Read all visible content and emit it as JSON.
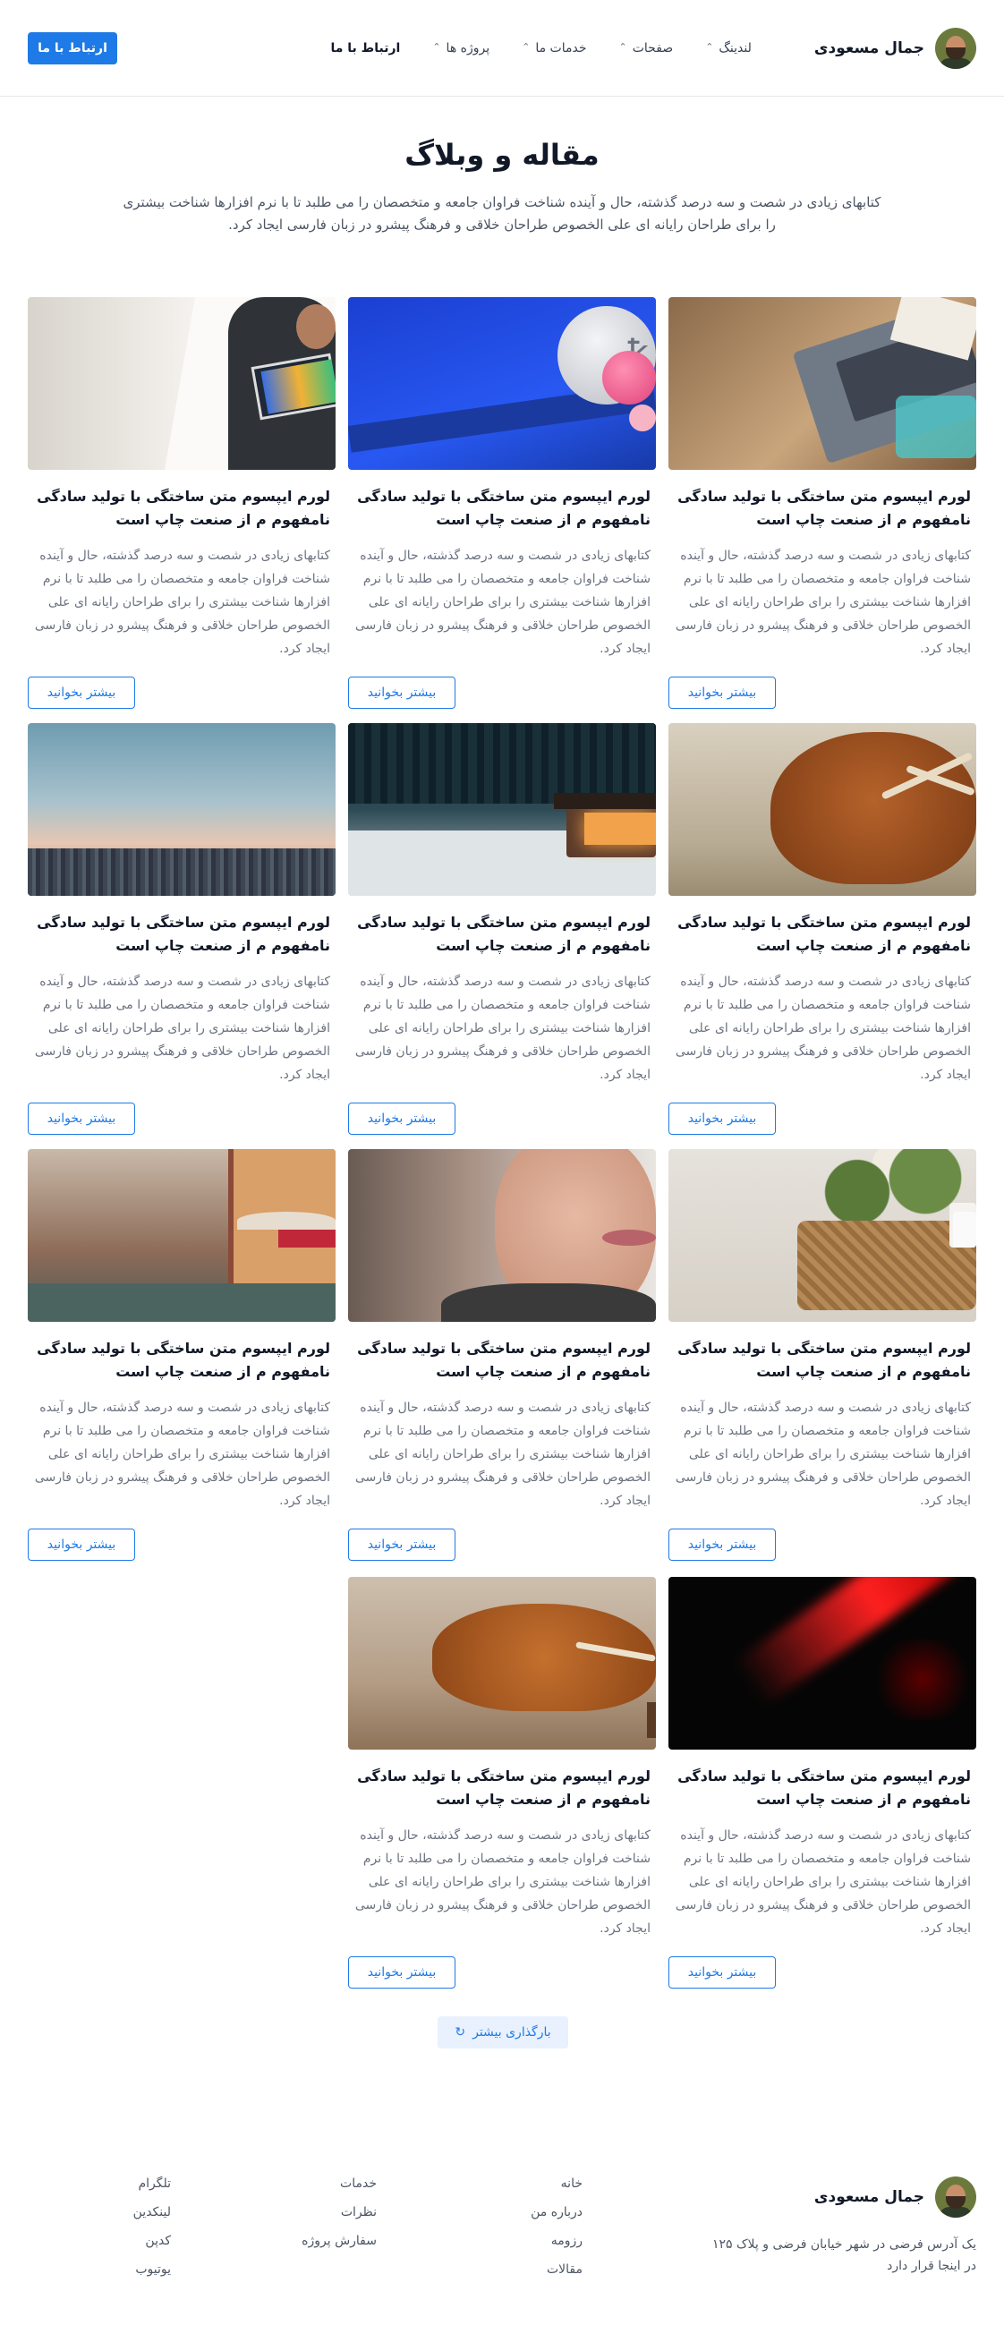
{
  "header": {
    "brand_name": "جمال مسعودی",
    "nav": [
      {
        "label": "لندینگ",
        "has_dropdown": true
      },
      {
        "label": "صفحات",
        "has_dropdown": true
      },
      {
        "label": "خدمات ما",
        "has_dropdown": true
      },
      {
        "label": "پروژه ها",
        "has_dropdown": true
      },
      {
        "label": "ارتباط با ما",
        "has_dropdown": false
      }
    ],
    "cta_label": "ارتباط با ما"
  },
  "hero": {
    "title": "مقاله و وبلاگ",
    "subtitle": "کتابهای زیادی در شصت و سه درصد گذشته، حال و آینده شناخت فراوان جامعه و متخصصان را می طلبد تا با نرم افزارها شناخت بیشتری را برای طراحان رایانه ای علی الخصوص طراحان خلاقی و فرهنگ پیشرو در زبان فارسی ایجاد کرد."
  },
  "posts": [
    {
      "image": "laptop-desk",
      "title": "لورم ایپسوم متن ساختگی با تولید سادگی نامفهوم م از صنعت چاپ است",
      "excerpt": "کتابهای زیادی در شصت و سه درصد گذشته، حال و آینده شناخت فراوان جامعه و متخصصان را می طلبد تا با نرم افزارها شناخت بیشتری را برای طراحان رایانه ای علی الخصوص طراحان خلاقی و فرهنگ پیشرو در زبان فارسی ایجاد کرد.",
      "read_more": "بیشتر بخوانید"
    },
    {
      "image": "crypto-coin",
      "title": "لورم ایپسوم متن ساختگی با تولید سادگی نامفهوم م از صنعت چاپ است",
      "excerpt": "کتابهای زیادی در شصت و سه درصد گذشته، حال و آینده شناخت فراوان جامعه و متخصصان را می طلبد تا با نرم افزارها شناخت بیشتری را برای طراحان رایانه ای علی الخصوص طراحان خلاقی و فرهنگ پیشرو در زبان فارسی ایجاد کرد.",
      "read_more": "بیشتر بخوانید"
    },
    {
      "image": "artist-tablet",
      "title": "لورم ایپسوم متن ساختگی با تولید سادگی نامفهوم م از صنعت چاپ است",
      "excerpt": "کتابهای زیادی در شصت و سه درصد گذشته، حال و آینده شناخت فراوان جامعه و متخصصان را می طلبد تا با نرم افزارها شناخت بیشتری را برای طراحان رایانه ای علی الخصوص طراحان خلاقی و فرهنگ پیشرو در زبان فارسی ایجاد کرد.",
      "read_more": "بیشتر بخوانید"
    },
    {
      "image": "highland-cow",
      "title": "لورم ایپسوم متن ساختگی با تولید سادگی نامفهوم م از صنعت چاپ است",
      "excerpt": "کتابهای زیادی در شصت و سه درصد گذشته، حال و آینده شناخت فراوان جامعه و متخصصان را می طلبد تا با نرم افزارها شناخت بیشتری را برای طراحان رایانه ای علی الخصوص طراحان خلاقی و فرهنگ پیشرو در زبان فارسی ایجاد کرد.",
      "read_more": "بیشتر بخوانید"
    },
    {
      "image": "cabin-forest",
      "title": "لورم ایپسوم متن ساختگی با تولید سادگی نامفهوم م از صنعت چاپ است",
      "excerpt": "کتابهای زیادی در شصت و سه درصد گذشته، حال و آینده شناخت فراوان جامعه و متخصصان را می طلبد تا با نرم افزارها شناخت بیشتری را برای طراحان رایانه ای علی الخصوص طراحان خلاقی و فرهنگ پیشرو در زبان فارسی ایجاد کرد.",
      "read_more": "بیشتر بخوانید"
    },
    {
      "image": "city-dusk",
      "title": "لورم ایپسوم متن ساختگی با تولید سادگی نامفهوم م از صنعت چاپ است",
      "excerpt": "کتابهای زیادی در شصت و سه درصد گذشته، حال و آینده شناخت فراوان جامعه و متخصصان را می طلبد تا با نرم افزارها شناخت بیشتری را برای طراحان رایانه ای علی الخصوص طراحان خلاقی و فرهنگ پیشرو در زبان فارسی ایجاد کرد.",
      "read_more": "بیشتر بخوانید"
    },
    {
      "image": "basket-cosmetics",
      "title": "لورم ایپسوم متن ساختگی با تولید سادگی نامفهوم م از صنعت چاپ است",
      "excerpt": "کتابهای زیادی در شصت و سه درصد گذشته، حال و آینده شناخت فراوان جامعه و متخصصان را می طلبد تا با نرم افزارها شناخت بیشتری را برای طراحان رایانه ای علی الخصوص طراحان خلاقی و فرهنگ پیشرو در زبان فارسی ایجاد کرد.",
      "read_more": "بیشتر بخوانید"
    },
    {
      "image": "woman-face",
      "title": "لورم ایپسوم متن ساختگی با تولید سادگی نامفهوم م از صنعت چاپ است",
      "excerpt": "کتابهای زیادی در شصت و سه درصد گذشته، حال و آینده شناخت فراوان جامعه و متخصصان را می طلبد تا با نرم افزارها شناخت بیشتری را برای طراحان رایانه ای علی الخصوص طراحان خلاقی و فرهنگ پیشرو در زبان فارسی ایجاد کرد.",
      "read_more": "بیشتر بخوانید"
    },
    {
      "image": "venice-canal",
      "title": "لورم ایپسوم متن ساختگی با تولید سادگی نامفهوم م از صنعت چاپ است",
      "excerpt": "کتابهای زیادی در شصت و سه درصد گذشته، حال و آینده شناخت فراوان جامعه و متخصصان را می طلبد تا با نرم افزارها شناخت بیشتری را برای طراحان رایانه ای علی الخصوص طراحان خلاقی و فرهنگ پیشرو در زبان فارسی ایجاد کرد.",
      "read_more": "بیشتر بخوانید"
    },
    {
      "image": "red-light",
      "title": "لورم ایپسوم متن ساختگی با تولید سادگی نامفهوم م از صنعت چاپ است",
      "excerpt": "کتابهای زیادی در شصت و سه درصد گذشته، حال و آینده شناخت فراوان جامعه و متخصصان را می طلبد تا با نرم افزارها شناخت بیشتری را برای طراحان رایانه ای علی الخصوص طراحان خلاقی و فرهنگ پیشرو در زبان فارسی ایجاد کرد.",
      "read_more": "بیشتر بخوانید"
    },
    {
      "image": "highland-cow-grazing",
      "title": "لورم ایپسوم متن ساختگی با تولید سادگی نامفهوم م از صنعت چاپ است",
      "excerpt": "کتابهای زیادی در شصت و سه درصد گذشته، حال و آینده شناخت فراوان جامعه و متخصصان را می طلبد تا با نرم افزارها شناخت بیشتری را برای طراحان رایانه ای علی الخصوص طراحان خلاقی و فرهنگ پیشرو در زبان فارسی ایجاد کرد.",
      "read_more": "بیشتر بخوانید"
    }
  ],
  "load_more": {
    "label": "بارگذاری بیشتر",
    "icon": "refresh-icon"
  },
  "footer": {
    "brand_name": "جمال مسعودی",
    "address": "یک آدرس فرضی در شهر خیابان فرضی و پلاک ۱۲۵ در اینجا قرار دارد",
    "col1": [
      "خانه",
      "درباره من",
      "رزومه",
      "مقالات"
    ],
    "col2": [
      "خدمات",
      "نظرات",
      "سفارش پروژه"
    ],
    "col3": [
      "تلگرام",
      "لینکدین",
      "کدپن",
      "یوتیوب"
    ]
  },
  "colors": {
    "accent": "#1e7ae6",
    "text": "#111827",
    "muted": "#6b7280"
  }
}
